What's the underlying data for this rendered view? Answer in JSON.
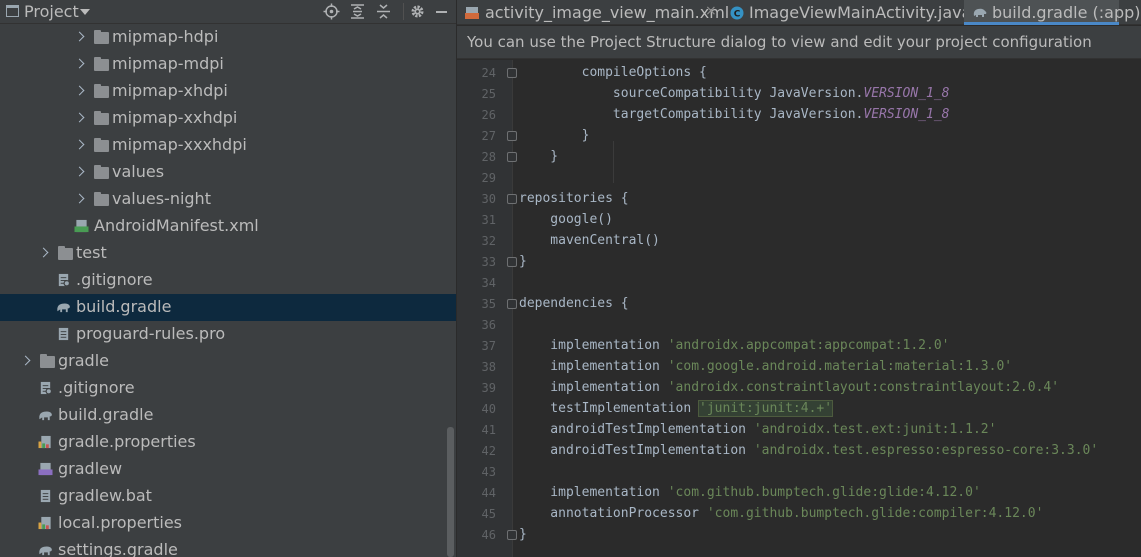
{
  "project_panel": {
    "title": "Project",
    "header_icons": [
      "crosshair-icon",
      "expand-all-icon",
      "collapse-all-icon",
      "gear-icon",
      "hide-icon"
    ],
    "tree": [
      {
        "label": "mipmap-hdpi",
        "icon": "folder-icon",
        "expandable": true,
        "selected": false
      },
      {
        "label": "mipmap-mdpi",
        "icon": "folder-icon",
        "expandable": true,
        "selected": false
      },
      {
        "label": "mipmap-xhdpi",
        "icon": "folder-icon",
        "expandable": true,
        "selected": false
      },
      {
        "label": "mipmap-xxhdpi",
        "icon": "folder-icon",
        "expandable": true,
        "selected": false
      },
      {
        "label": "mipmap-xxxhdpi",
        "icon": "folder-icon",
        "expandable": true,
        "selected": false
      },
      {
        "label": "values",
        "icon": "folder-icon",
        "expandable": true,
        "selected": false
      },
      {
        "label": "values-night",
        "icon": "folder-icon",
        "expandable": true,
        "selected": false
      },
      {
        "label": "AndroidManifest.xml",
        "icon": "manifest-file-icon",
        "expandable": false,
        "selected": false
      },
      {
        "label": "test",
        "icon": "folder-icon",
        "expandable": true,
        "selected": false
      },
      {
        "label": ".gitignore",
        "icon": "gitignore-file-icon",
        "expandable": false,
        "selected": false
      },
      {
        "label": "build.gradle",
        "icon": "gradle-elephant-icon",
        "expandable": false,
        "selected": true
      },
      {
        "label": "proguard-rules.pro",
        "icon": "text-file-icon",
        "expandable": false,
        "selected": false
      },
      {
        "label": "gradle",
        "icon": "folder-icon",
        "expandable": true,
        "selected": false
      },
      {
        "label": ".gitignore",
        "icon": "gitignore-file-icon",
        "expandable": false,
        "selected": false
      },
      {
        "label": "build.gradle",
        "icon": "gradle-elephant-icon",
        "expandable": false,
        "selected": false
      },
      {
        "label": "gradle.properties",
        "icon": "properties-file-icon",
        "expandable": false,
        "selected": false
      },
      {
        "label": "gradlew",
        "icon": "shell-script-icon",
        "expandable": false,
        "selected": false
      },
      {
        "label": "gradlew.bat",
        "icon": "text-file-icon",
        "expandable": false,
        "selected": false
      },
      {
        "label": "local.properties",
        "icon": "properties-file-icon",
        "expandable": false,
        "selected": false
      },
      {
        "label": "settings.gradle",
        "icon": "gradle-elephant-icon",
        "expandable": false,
        "selected": false
      }
    ]
  },
  "editor": {
    "tabs": [
      {
        "label": "activity_image_view_main.xml",
        "icon": "xml-file-icon",
        "active": false,
        "closable": true
      },
      {
        "label": "ImageViewMainActivity.java",
        "icon": "java-class-icon",
        "active": false,
        "closable": false
      },
      {
        "label": "build.gradle (:app)",
        "icon": "gradle-elephant-icon",
        "active": true,
        "closable": false
      }
    ],
    "tab_close_glyph": "×",
    "notice": "You can use the Project Structure dialog to view and edit your project configuration",
    "lines": [
      {
        "num": "24",
        "parts": [
          [
            "t",
            "        compileOptions {"
          ]
        ]
      },
      {
        "num": "25",
        "parts": [
          [
            "t",
            "            sourceCompatibility JavaVersion."
          ],
          [
            "c",
            "VERSION_1_8"
          ]
        ]
      },
      {
        "num": "26",
        "parts": [
          [
            "t",
            "            targetCompatibility JavaVersion."
          ],
          [
            "c",
            "VERSION_1_8"
          ]
        ]
      },
      {
        "num": "27",
        "parts": [
          [
            "t",
            "        }"
          ]
        ]
      },
      {
        "num": "28",
        "parts": [
          [
            "t",
            "    }"
          ]
        ]
      },
      {
        "num": "29",
        "parts": []
      },
      {
        "num": "30",
        "parts": [
          [
            "t",
            "repositories {"
          ]
        ]
      },
      {
        "num": "31",
        "parts": [
          [
            "t",
            "    google()"
          ]
        ]
      },
      {
        "num": "32",
        "parts": [
          [
            "t",
            "    mavenCentral()"
          ]
        ]
      },
      {
        "num": "33",
        "parts": [
          [
            "t",
            "}"
          ]
        ]
      },
      {
        "num": "34",
        "parts": []
      },
      {
        "num": "35",
        "parts": [
          [
            "t",
            "dependencies {"
          ]
        ]
      },
      {
        "num": "36",
        "parts": []
      },
      {
        "num": "37",
        "parts": [
          [
            "t",
            "    implementation "
          ],
          [
            "s",
            "'androidx.appcompat:appcompat:1.2.0'"
          ]
        ]
      },
      {
        "num": "38",
        "parts": [
          [
            "t",
            "    implementation "
          ],
          [
            "s",
            "'com.google.android.material:material:1.3.0'"
          ]
        ]
      },
      {
        "num": "39",
        "parts": [
          [
            "t",
            "    implementation "
          ],
          [
            "s",
            "'androidx.constraintlayout:constraintlayout:2.0.4'"
          ]
        ]
      },
      {
        "num": "40",
        "parts": [
          [
            "t",
            "    testImplementation "
          ],
          [
            "h",
            "'junit:junit:4.+'"
          ]
        ]
      },
      {
        "num": "41",
        "parts": [
          [
            "t",
            "    androidTestImplementation "
          ],
          [
            "s",
            "'androidx.test.ext:junit:1.1.2'"
          ]
        ]
      },
      {
        "num": "42",
        "parts": [
          [
            "t",
            "    androidTestImplementation "
          ],
          [
            "s",
            "'androidx.test.espresso:espresso-core:3.3.0'"
          ]
        ]
      },
      {
        "num": "43",
        "parts": []
      },
      {
        "num": "44",
        "parts": [
          [
            "t",
            "    implementation "
          ],
          [
            "s",
            "'com.github.bumptech.glide:glide:4.12.0'"
          ]
        ]
      },
      {
        "num": "45",
        "parts": [
          [
            "t",
            "    annotationProcessor "
          ],
          [
            "s",
            "'com.github.bumptech.glide:compiler:4.12.0'"
          ]
        ]
      },
      {
        "num": "46",
        "parts": [
          [
            "t",
            "}"
          ]
        ]
      }
    ]
  },
  "colors": {
    "panel_bg": "#3c3f41",
    "editor_bg": "#2b2b2b",
    "selection": "#0d293e",
    "string": "#6a8759",
    "constant": "#9876aa",
    "text": "#a9b7c6",
    "accent": "#4a88c7"
  }
}
